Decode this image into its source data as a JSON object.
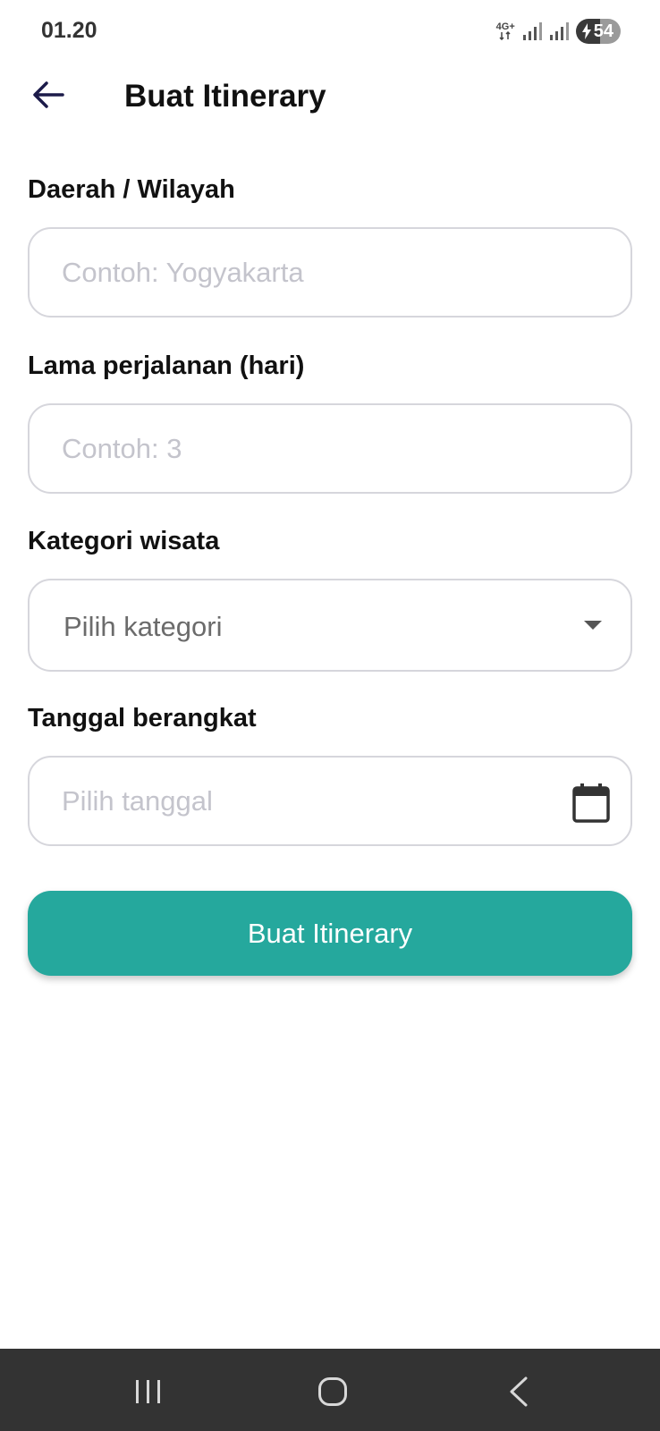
{
  "status_bar": {
    "time": "01.20",
    "network": "4G+",
    "battery": "54",
    "icons": [
      "network-4g-icon",
      "signal-icon",
      "signal-icon",
      "battery-charging-icon"
    ]
  },
  "app_bar": {
    "title": "Buat Itinerary",
    "back_icon": "arrow-left-icon"
  },
  "form": {
    "region": {
      "label": "Daerah / Wilayah",
      "placeholder": "Contoh: Yogyakarta",
      "value": ""
    },
    "duration": {
      "label": "Lama perjalanan (hari)",
      "placeholder": "Contoh: 3",
      "value": ""
    },
    "category": {
      "label": "Kategori wisata",
      "selected": "Pilih kategori",
      "icon": "caret-down-icon"
    },
    "date": {
      "label": "Tanggal berangkat",
      "placeholder": "Pilih tanggal",
      "value": "",
      "icon": "calendar-icon"
    },
    "submit_label": "Buat Itinerary"
  },
  "nav_bar": {
    "icons": [
      "recent-apps-icon",
      "home-icon",
      "back-icon"
    ]
  },
  "colors": {
    "accent": "#25a89d",
    "border": "#d6d6dc",
    "placeholder": "#c4c4cc",
    "nav_background": "#333333"
  }
}
